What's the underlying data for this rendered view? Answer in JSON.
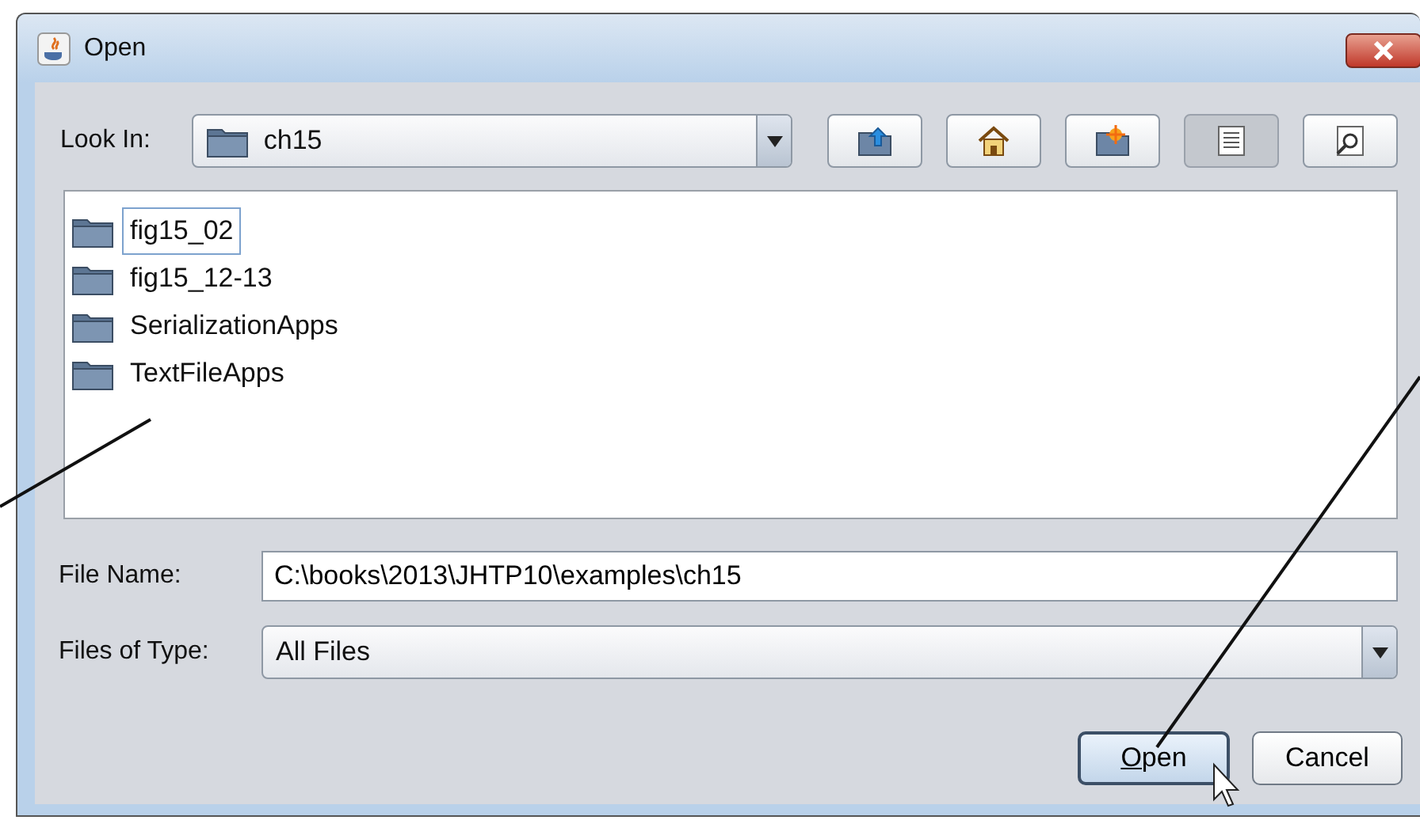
{
  "window": {
    "title": "Open"
  },
  "look_in": {
    "label": "Look In:",
    "value": "ch15"
  },
  "toolbar_buttons": [
    {
      "kind": "up",
      "selected": false
    },
    {
      "kind": "home",
      "selected": false
    },
    {
      "kind": "new-folder",
      "selected": false
    },
    {
      "kind": "list",
      "selected": true
    },
    {
      "kind": "details",
      "selected": false
    }
  ],
  "files": [
    {
      "name": "fig15_02",
      "selected": true
    },
    {
      "name": "fig15_12-13",
      "selected": false
    },
    {
      "name": "SerializationApps",
      "selected": false
    },
    {
      "name": "TextFileApps",
      "selected": false
    }
  ],
  "file_name": {
    "label": "File Name:",
    "value": "C:\\books\\2013\\JHTP10\\examples\\ch15"
  },
  "files_of_type": {
    "label": "Files of Type:",
    "value": "All Files"
  },
  "buttons": [
    {
      "label": "Open",
      "kind": "default"
    },
    {
      "label": "Cancel",
      "kind": "normal"
    }
  ]
}
